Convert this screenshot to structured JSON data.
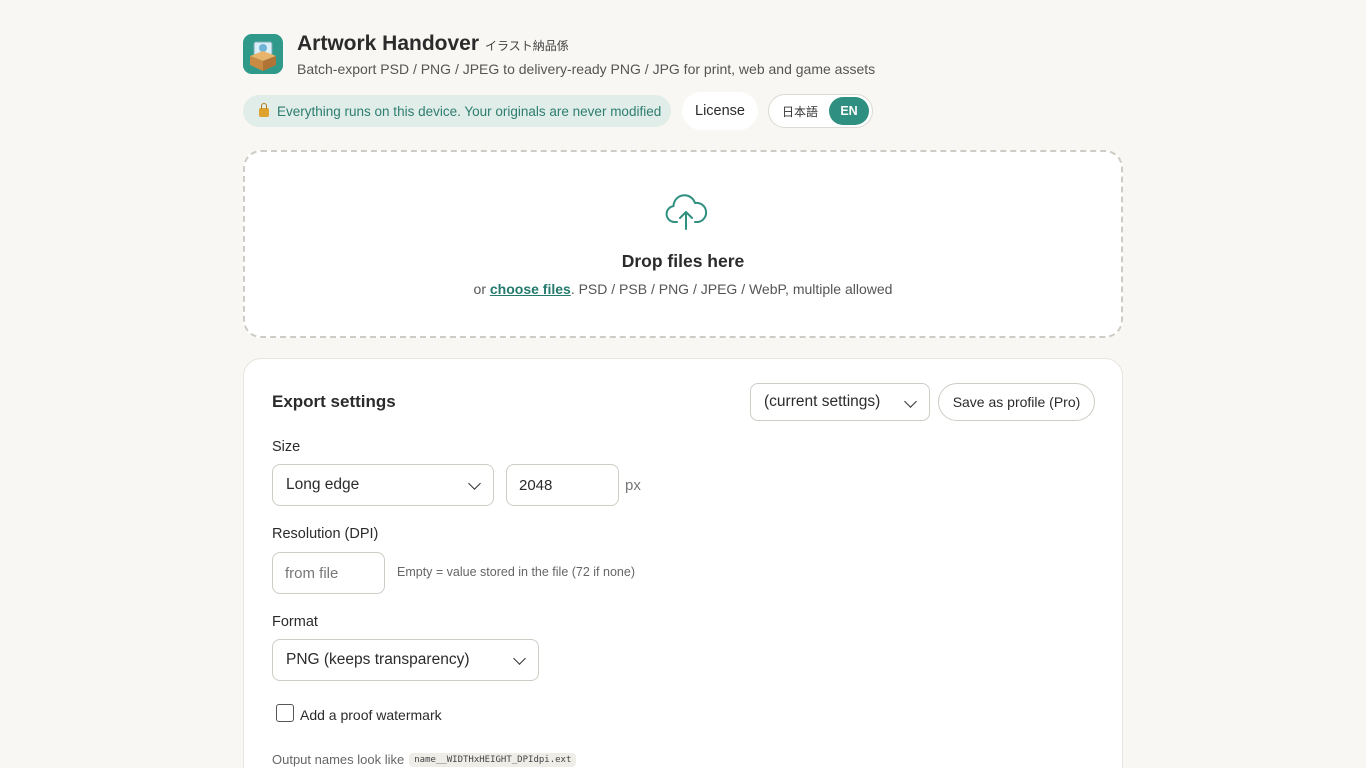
{
  "header": {
    "title": "Artwork Handover",
    "title_jp": "イラスト納品係",
    "subtitle": "Batch-export PSD / PNG / JPEG to delivery-ready PNG / JPG for print, web and game assets"
  },
  "privacy_badge": {
    "icon": "lock-icon",
    "text": "Everything runs on this device. Your originals are never modified"
  },
  "license_label": "License",
  "language": {
    "options": [
      "日本語",
      "EN"
    ],
    "selected": "EN"
  },
  "drop_zone": {
    "icon": "cloud-upload-icon",
    "title": "Drop files here",
    "hint_prefix": "or ",
    "choose_link": "choose files",
    "hint_suffix": ". PSD / PSB / PNG / JPEG / WebP, multiple allowed"
  },
  "settings": {
    "title": "Export settings",
    "profile_selected": "(current settings)",
    "save_profile_label": "Save as profile (Pro)",
    "size": {
      "label": "Size",
      "mode": "Long edge",
      "value": "2048",
      "unit": "px"
    },
    "resolution": {
      "label": "Resolution (DPI)",
      "placeholder": "from file",
      "hint": "Empty = value stored in the file (72 if none)"
    },
    "format": {
      "label": "Format",
      "selected": "PNG (keeps transparency)"
    },
    "watermark": {
      "label": "Add a proof watermark",
      "checked": false
    },
    "output": {
      "label": "Output names look like",
      "pattern": "name__WIDTHxHEIGHT_DPIdpi.ext"
    }
  },
  "colors": {
    "accent": "#2f8f80",
    "background": "#f8f7f3",
    "badge_bg": "#e1ede9"
  }
}
